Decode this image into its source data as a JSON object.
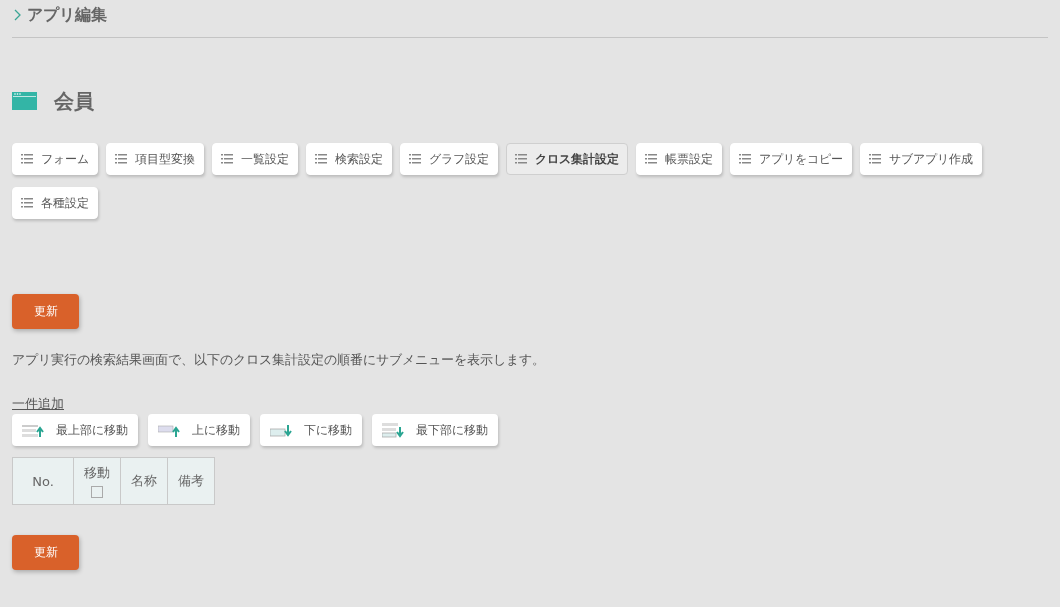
{
  "breadcrumb": {
    "label": "アプリ編集"
  },
  "app": {
    "title": "会員"
  },
  "menu": [
    {
      "label": "フォーム",
      "selected": false
    },
    {
      "label": "項目型変換",
      "selected": false
    },
    {
      "label": "一覧設定",
      "selected": false
    },
    {
      "label": "検索設定",
      "selected": false
    },
    {
      "label": "グラフ設定",
      "selected": false
    },
    {
      "label": "クロス集計設定",
      "selected": true
    },
    {
      "label": "帳票設定",
      "selected": false
    },
    {
      "label": "アプリをコピー",
      "selected": false
    },
    {
      "label": "サブアプリ作成",
      "selected": false
    },
    {
      "label": "各種設定",
      "selected": false
    }
  ],
  "update_button_top": "更新",
  "description": "アプリ実行の検索結果画面で、以下のクロス集計設定の順番にサブメニューを表示します。",
  "add_link": "一件追加",
  "move_buttons": [
    {
      "kind": "top",
      "label": "最上部に移動"
    },
    {
      "kind": "up",
      "label": "上に移動"
    },
    {
      "kind": "down",
      "label": "下に移動"
    },
    {
      "kind": "bottom",
      "label": "最下部に移動"
    }
  ],
  "table": {
    "columns": [
      {
        "kind": "text",
        "label": "No."
      },
      {
        "kind": "checkbox",
        "label": "移動",
        "checked": false
      },
      {
        "kind": "text",
        "label": "名称"
      },
      {
        "kind": "text",
        "label": "備考"
      }
    ]
  },
  "update_button_bottom": "更新"
}
